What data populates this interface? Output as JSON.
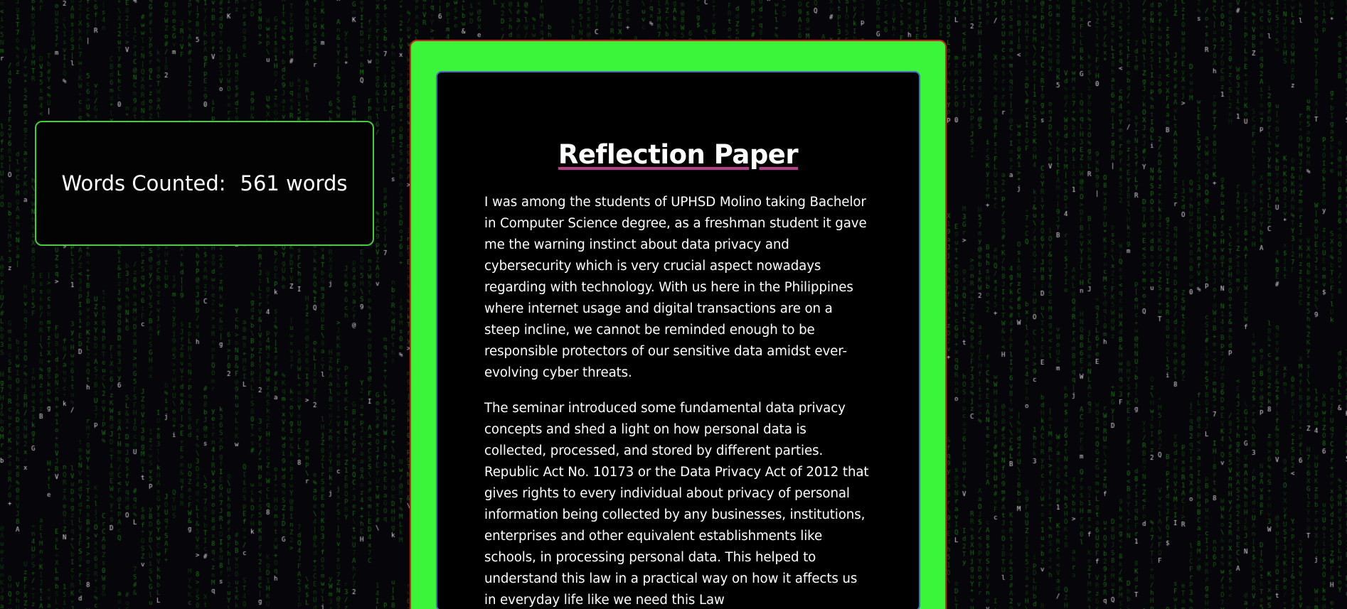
{
  "background": {
    "effect": "matrix-rain",
    "glyph_color": "#1f9a1a",
    "highlight_color": "#d8d8d8",
    "base_color": "#060509"
  },
  "word_count": {
    "label": "Words Counted:",
    "value": "561 words",
    "border_color": "#3ecf3a"
  },
  "paper": {
    "frame_color": "#3bf53a",
    "frame_border_color": "#d81e1e",
    "inner_border_color": "#4a66c8",
    "title": "Reflection Paper",
    "title_underline_color": "#c0378f",
    "paragraphs": [
      "I was among the students of UPHSD Molino taking Bachelor in Computer Science degree, as a freshman student it gave me the warning instinct about data privacy and cybersecurity which is very crucial aspect nowadays regarding with technology. With us here in the Philippines where internet usage and digital transactions are on a steep incline, we cannot be reminded enough to be responsible protectors of our sensitive data amidst ever-evolving cyber threats.",
      "The seminar introduced some fundamental data privacy concepts and shed a light on how personal data is collected, processed, and stored by different parties. Republic Act No. 10173 or the Data Privacy Act of 2012 that gives rights to every individual about privacy of personal information being collected by any businesses, institutions, enterprises and other equivalent establishments like schools, in processing personal data. This helped to understand this law in a practical way on how it affects us in everyday life like we need this Law"
    ]
  }
}
